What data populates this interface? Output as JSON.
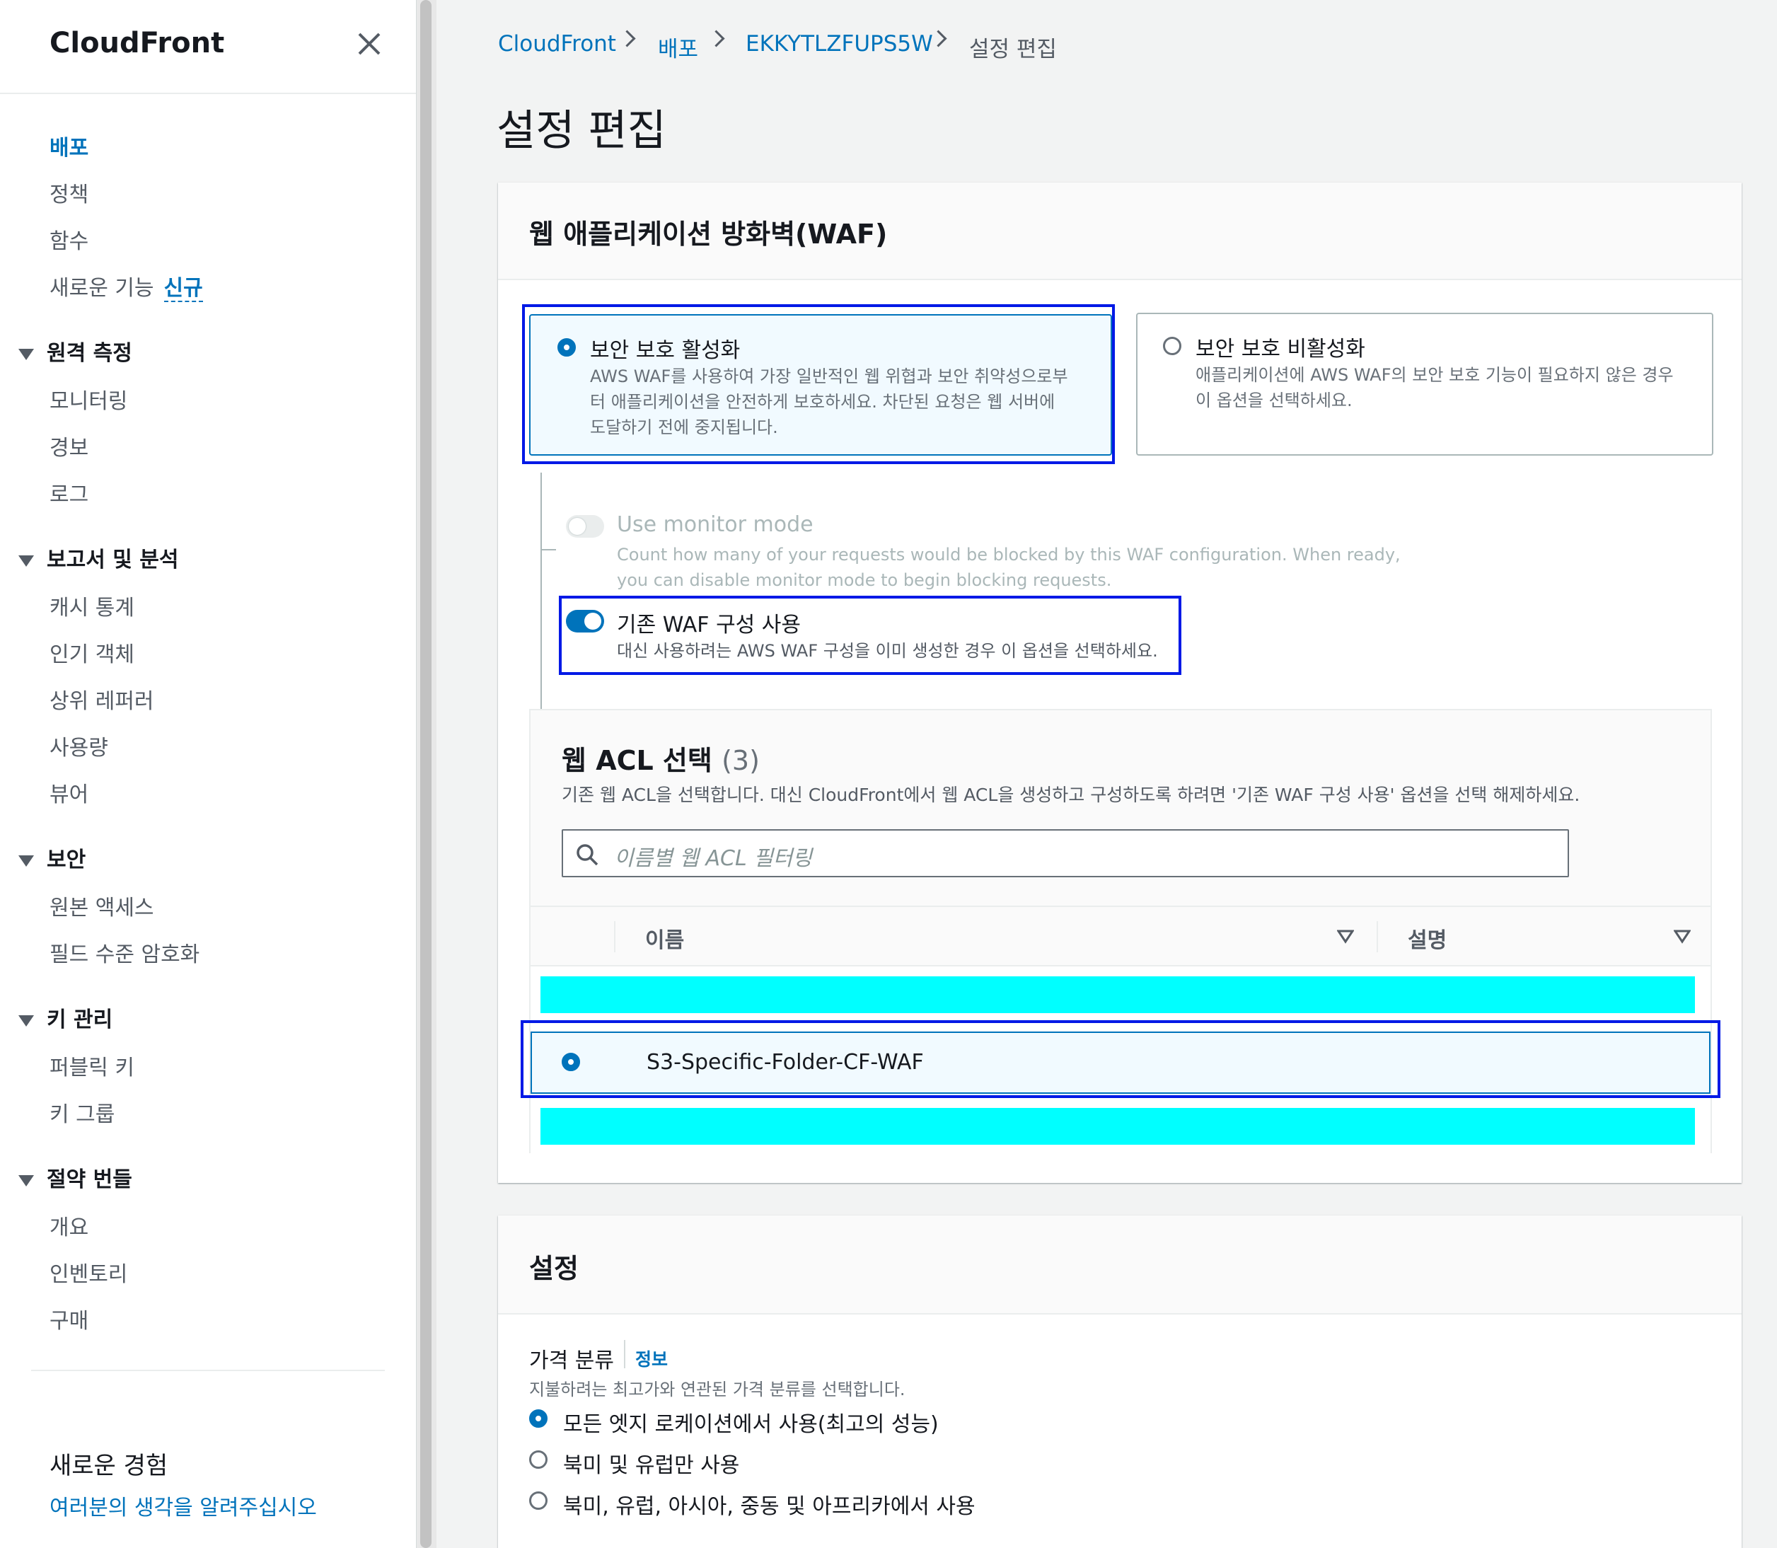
{
  "sidebar": {
    "title": "CloudFront",
    "items": {
      "distributions": "배포",
      "policies": "정책",
      "functions": "함수",
      "whats_new": "새로운 기능",
      "new_badge": "신규"
    },
    "telemetry": {
      "label": "원격 측정",
      "items": [
        "모니터링",
        "경보",
        "로그"
      ]
    },
    "reports": {
      "label": "보고서 및 분석",
      "items": [
        "캐시 통계",
        "인기 객체",
        "상위 레퍼러",
        "사용량",
        "뷰어"
      ]
    },
    "security": {
      "label": "보안",
      "items": [
        "원본 액세스",
        "필드 수준 암호화"
      ]
    },
    "key_mgmt": {
      "label": "키 관리",
      "items": [
        "퍼블릭 키",
        "키 그룹"
      ]
    },
    "savings": {
      "label": "절약 번들",
      "items": [
        "개요",
        "인벤토리",
        "구매"
      ]
    },
    "experience_title": "새로운 경험",
    "experience_link": "여러분의 생각을 알려주십시오"
  },
  "breadcrumb": [
    "CloudFront",
    "배포",
    "EKKYTLZFUPS5W",
    "설정 편집"
  ],
  "page_title": "설정 편집",
  "waf": {
    "title": "웹 애플리케이션 방화벽(WAF)",
    "enable": {
      "title": "보안 보호 활성화",
      "desc": [
        "AWS WAF를 사용하여 가장 일반적인 웹 위협과 보안 취약성으로부",
        "터 애플리케이션을 안전하게 보호하세요. 차단된 요청은 웹 서버에",
        "도달하기 전에 중지됩니다."
      ]
    },
    "disable": {
      "title": "보안 보호 비활성화",
      "desc": [
        "애플리케이션에 AWS WAF의 보안 보호 기능이 필요하지 않은 경우",
        "이 옵션을 선택하세요."
      ]
    },
    "monitor": {
      "title": "Use monitor mode",
      "desc": [
        "Count how many of your requests would be blocked by this WAF configuration. When ready,",
        "you can disable monitor mode to begin blocking requests."
      ]
    },
    "existing": {
      "title": "기존 WAF 구성 사용",
      "desc": "대신 사용하려는 AWS WAF 구성을 이미 생성한 경우 이 옵션을 선택하세요."
    },
    "acl": {
      "title": "웹 ACL 선택",
      "count": "(3)",
      "desc": "기존 웹 ACL을 선택합니다. 대신 CloudFront에서 웹 ACL을 생성하고 구성하도록 하려면 '기존 WAF 구성 사용' 옵션을 선택 해제하세요.",
      "filter_placeholder": "이름별 웹 ACL 필터링",
      "col_name": "이름",
      "col_desc": "설명",
      "selected_row": "S3-Specific-Folder-CF-WAF"
    }
  },
  "settings": {
    "title": "설정",
    "price_label": "가격 분류",
    "info": "정보",
    "price_desc": "지불하려는 최고가와 연관된 가격 분류를 선택합니다.",
    "options": [
      "모든 엣지 로케이션에서 사용(최고의 성능)",
      "북미 및 유럽만 사용",
      "북미, 유럽, 아시아, 중동 및 아프리카에서 사용"
    ]
  },
  "colors": {
    "accent": "#0073bb",
    "highlight": "#0019e6",
    "redact": "#00ffff"
  }
}
